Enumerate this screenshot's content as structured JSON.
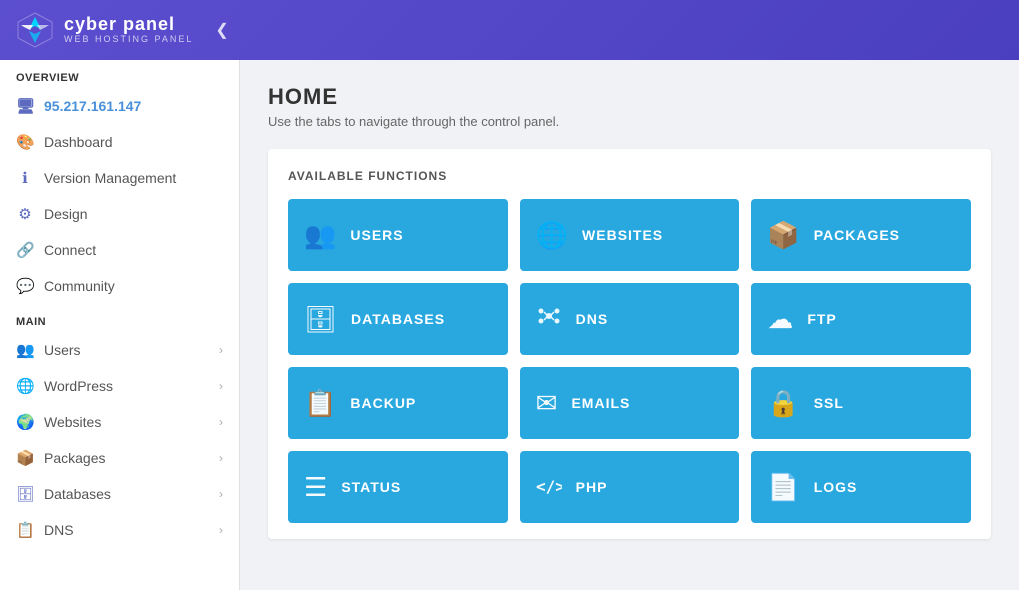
{
  "header": {
    "logo_title": "cyber panel",
    "logo_subtitle": "WEB HOSTING PANEL",
    "collapse_icon": "❮"
  },
  "sidebar": {
    "overview_label": "OVERVIEW",
    "ip_address": "95.217.161.147",
    "overview_items": [
      {
        "id": "dashboard",
        "label": "Dashboard",
        "icon": "🎨"
      },
      {
        "id": "version-management",
        "label": "Version Management",
        "icon": "ℹ"
      },
      {
        "id": "design",
        "label": "Design",
        "icon": "⚙"
      },
      {
        "id": "connect",
        "label": "Connect",
        "icon": "🔗"
      },
      {
        "id": "community",
        "label": "Community",
        "icon": "💬"
      }
    ],
    "main_label": "MAIN",
    "main_items": [
      {
        "id": "users",
        "label": "Users",
        "icon": "👥",
        "has_arrow": true
      },
      {
        "id": "wordpress",
        "label": "WordPress",
        "icon": "🌐",
        "has_arrow": true
      },
      {
        "id": "websites",
        "label": "Websites",
        "icon": "🌍",
        "has_arrow": true
      },
      {
        "id": "packages",
        "label": "Packages",
        "icon": "📦",
        "has_arrow": true
      },
      {
        "id": "databases",
        "label": "Databases",
        "icon": "🗄",
        "has_arrow": true
      },
      {
        "id": "dns",
        "label": "DNS",
        "icon": "📋",
        "has_arrow": true
      }
    ]
  },
  "content": {
    "page_title": "HOME",
    "page_subtitle": "Use the tabs to navigate through the control panel.",
    "functions_label": "AVAILABLE FUNCTIONS",
    "functions": [
      {
        "id": "users",
        "label": "USERS",
        "icon": "👥"
      },
      {
        "id": "websites",
        "label": "WEBSITES",
        "icon": "🌐"
      },
      {
        "id": "packages",
        "label": "PACKAGES",
        "icon": "📦"
      },
      {
        "id": "databases",
        "label": "DATABASES",
        "icon": "🗄"
      },
      {
        "id": "dns",
        "label": "DNS",
        "icon": "📊"
      },
      {
        "id": "ftp",
        "label": "FTP",
        "icon": "☁"
      },
      {
        "id": "backup",
        "label": "BACKUP",
        "icon": "📋"
      },
      {
        "id": "emails",
        "label": "EMAILS",
        "icon": "✉"
      },
      {
        "id": "ssl",
        "label": "SSL",
        "icon": "🔒"
      },
      {
        "id": "status",
        "label": "STATUS",
        "icon": "☰"
      },
      {
        "id": "php",
        "label": "PHP",
        "icon": "⟨⟩"
      },
      {
        "id": "logs",
        "label": "LOGS",
        "icon": "📄"
      }
    ]
  }
}
